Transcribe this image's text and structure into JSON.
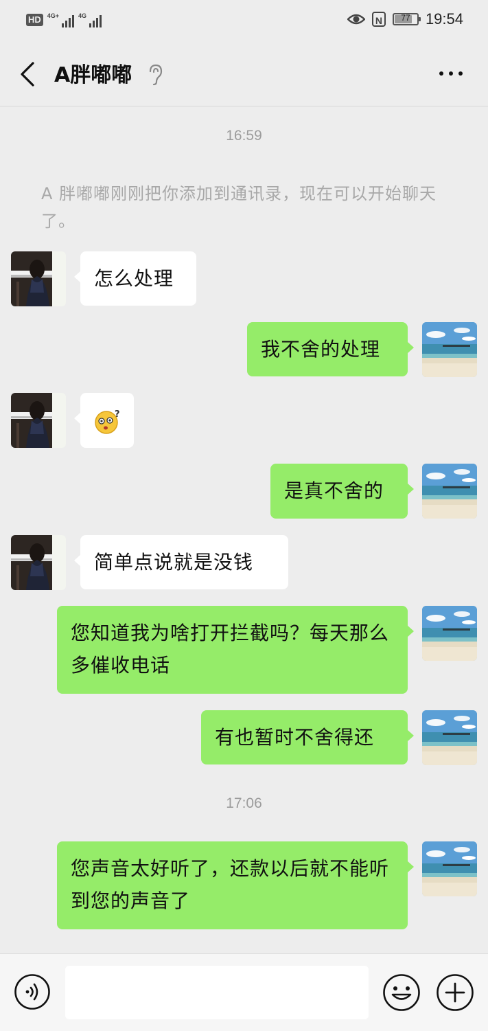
{
  "status_bar": {
    "hd": "HD",
    "net1": "4G+",
    "net2": "4G",
    "nfc": "N",
    "battery": "77",
    "battery_level": 0.77,
    "time": "19:54"
  },
  "header": {
    "title": "A胖嘟嘟",
    "icons": [
      "back-arrow-icon",
      "ear-icon",
      "more-dots-icon"
    ]
  },
  "timestamps": [
    "16:59",
    "17:06"
  ],
  "system_message": "A 胖嘟嘟刚刚把你添加到通讯录，现在可以开始聊天了。",
  "messages": [
    {
      "side": "left",
      "type": "text",
      "text": "怎么处理"
    },
    {
      "side": "right",
      "type": "text",
      "text": "我不舍的处理"
    },
    {
      "side": "left",
      "type": "emoji",
      "icon": "dizzy-face-emoji"
    },
    {
      "side": "right",
      "type": "text",
      "text": "是真不舍的"
    },
    {
      "side": "left",
      "type": "text",
      "text": "简单点说就是没钱"
    },
    {
      "side": "right",
      "type": "text",
      "text": "您知道我为啥打开拦截吗？每天那么多催收电话"
    },
    {
      "side": "right",
      "type": "text",
      "text": "有也暂时不舍得还"
    },
    {
      "side": "right",
      "type": "text",
      "text": "您声音太好听了，还款以后就不能听到您的声音了"
    }
  ],
  "input_bar": {
    "placeholder": "",
    "icons": [
      "voice-icon",
      "emoji-icon",
      "plus-icon"
    ]
  },
  "colors": {
    "background": "#ededed",
    "my_bubble": "#95ec69",
    "their_bubble": "#ffffff",
    "meta_text": "#9c9c9c"
  }
}
